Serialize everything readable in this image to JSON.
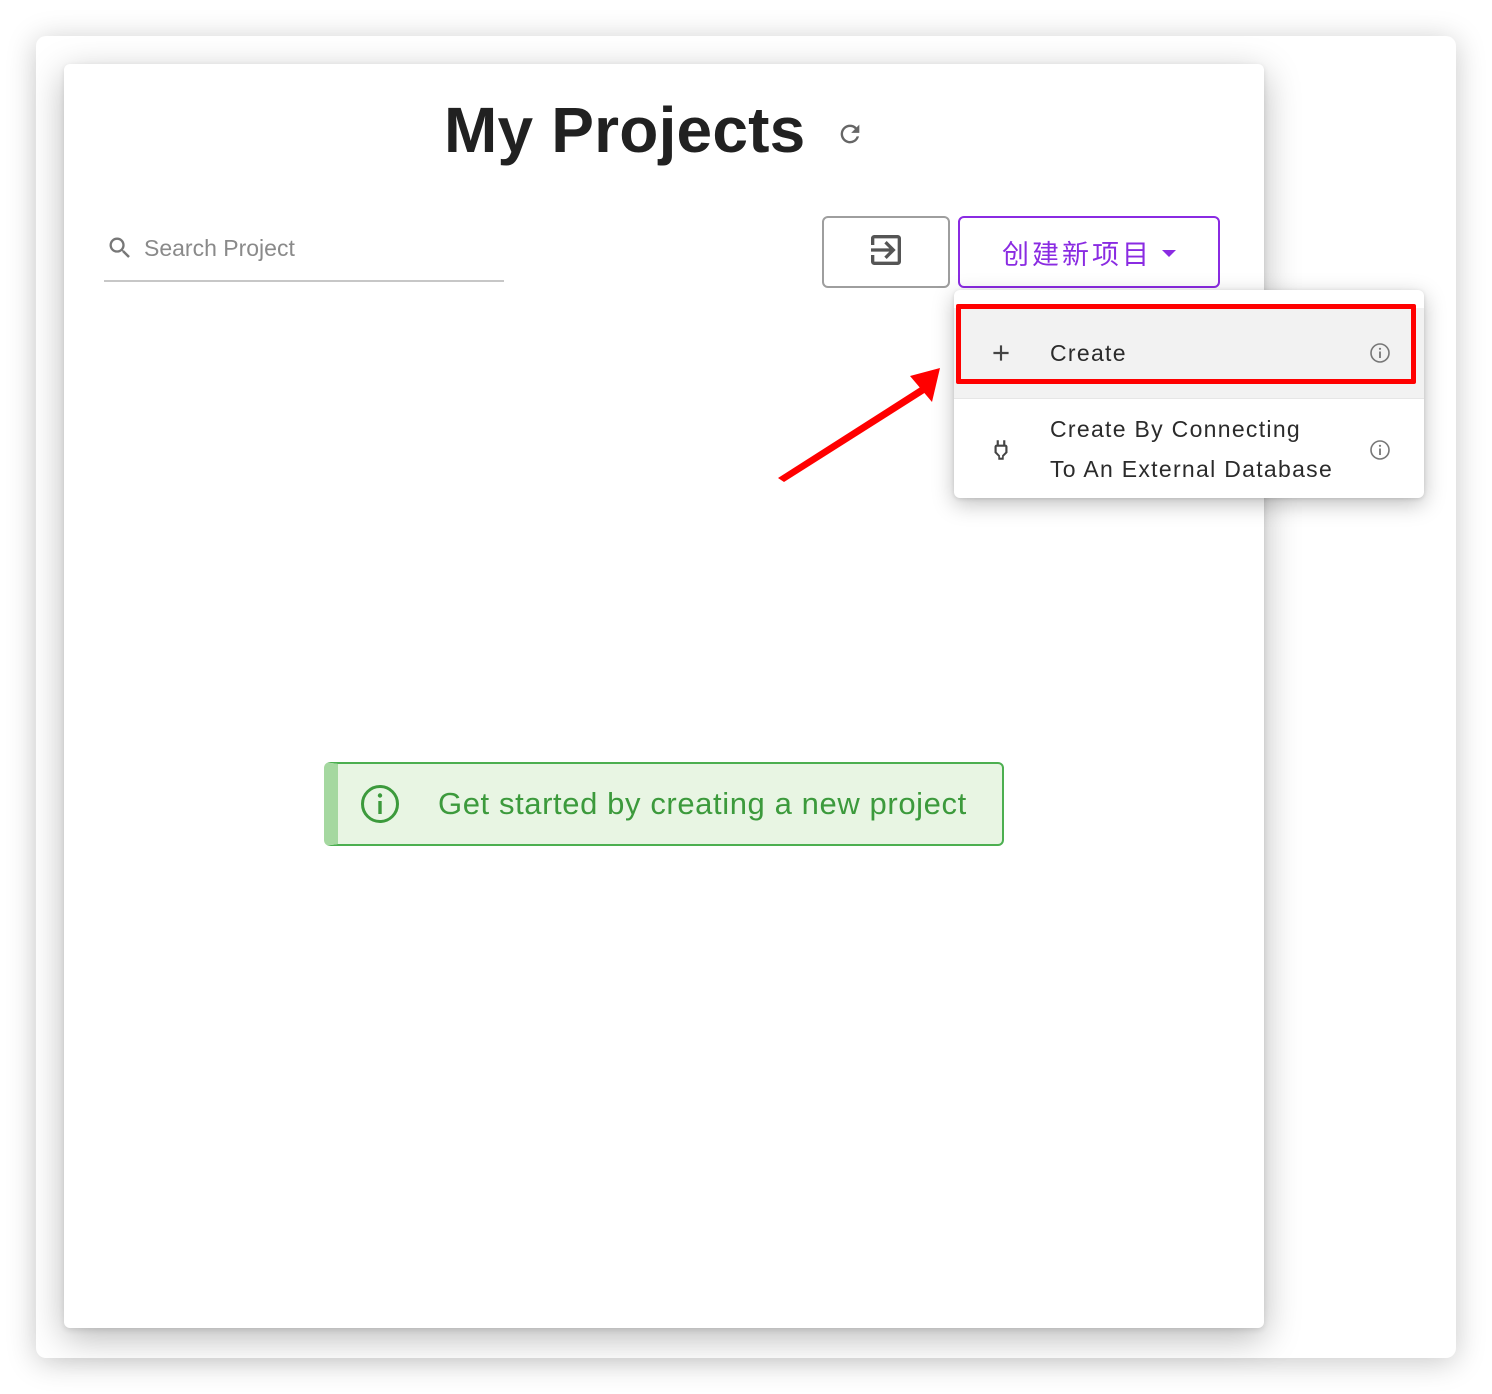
{
  "page": {
    "title": "My Projects"
  },
  "search": {
    "placeholder": "Search Project",
    "value": ""
  },
  "toolbar": {
    "import_icon": "import-icon",
    "create_menu_label": "创建新项目"
  },
  "dropdown": {
    "items": [
      {
        "icon": "plus-icon",
        "label": "Create",
        "info_icon": "info-icon",
        "highlighted": true
      },
      {
        "icon": "plug-icon",
        "label_line1": "Create By Connecting",
        "label_line2": "To An External Database",
        "info_icon": "info-icon"
      }
    ]
  },
  "banner": {
    "text": "Get started by creating a new project",
    "icon": "info-circle-icon"
  },
  "colors": {
    "accent": "#8a2be2",
    "success_text": "#3c9a3c",
    "success_border": "#4caf50",
    "success_bg": "#e8f5e3",
    "annotation_red": "#ff0000",
    "title_text": "#212121"
  }
}
